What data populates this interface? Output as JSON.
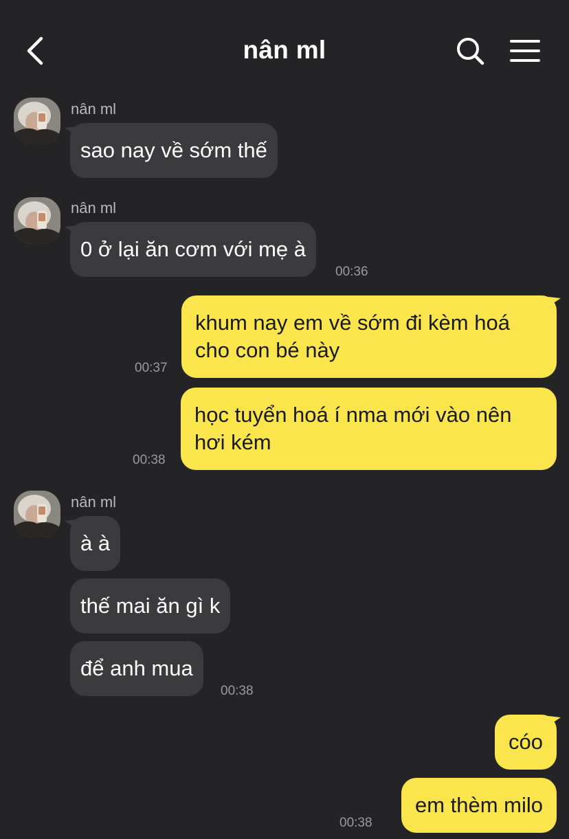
{
  "header": {
    "title": "nân ml"
  },
  "icons": {
    "back": "chevron-left-icon",
    "search": "search-icon",
    "menu": "hamburger-menu-icon"
  },
  "colors": {
    "background": "#242426",
    "incoming_bubble": "#3b3b3e",
    "outgoing_bubble": "#fae64c"
  },
  "messages": {
    "g1": {
      "sender": "nân ml",
      "text": "sao nay về sớm thế"
    },
    "g2": {
      "sender": "nân ml",
      "text": "0 ở lại ăn cơm với mẹ à",
      "time": "00:36"
    },
    "o1": {
      "line1": "khum nay em về sớm đi kèm hoá",
      "line2": "cho con bé này",
      "time": "00:37"
    },
    "o2": {
      "line1": "học tuyển hoá í nma mới vào nên",
      "line2": "hơi kém",
      "time": "00:38"
    },
    "g3": {
      "sender": "nân ml",
      "m1": "à à",
      "m2": "thế mai ăn gì k",
      "m3": "để anh mua",
      "time": "00:38"
    },
    "o3": {
      "m1": "cóo",
      "m2": "em thèm milo",
      "time": "00:38"
    }
  }
}
